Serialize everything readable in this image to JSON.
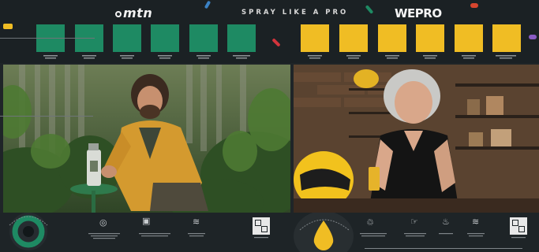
{
  "header": {
    "brand_left": "mtn",
    "tagline": "SPRAY LIKE A PRO",
    "brand_right": "WEPRO"
  },
  "colors": {
    "green": "#1e8a63",
    "yellow": "#f0bd24",
    "background": "#1f2528"
  },
  "icons": [
    "spray-can-icon",
    "wind-icon",
    "box-icon",
    "qr-code-icon",
    "drop-icon",
    "recycle-icon",
    "hand-icon",
    "flame-icon"
  ]
}
